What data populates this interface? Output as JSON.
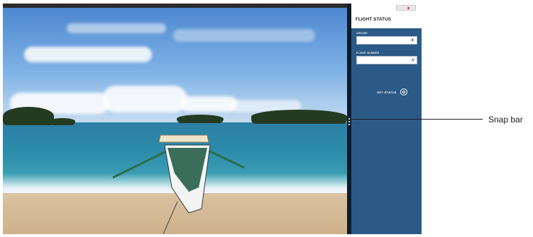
{
  "panel": {
    "title": "FLIGHT STATUS",
    "airline_label": "AIRLINE",
    "airline_value": "",
    "flight_number_label": "FLIGHT NUMBER",
    "flight_number_value": "",
    "get_status_label": "GET STATUS"
  },
  "icons": {
    "airline_field_icon": "plane-icon",
    "flight_number_field_icon": "hash-icon",
    "get_status_icon": "search-icon"
  },
  "callout": {
    "label": "Snap bar"
  },
  "colors": {
    "panel_bg": "#2c5a86",
    "divider": "#0e1b2a"
  }
}
